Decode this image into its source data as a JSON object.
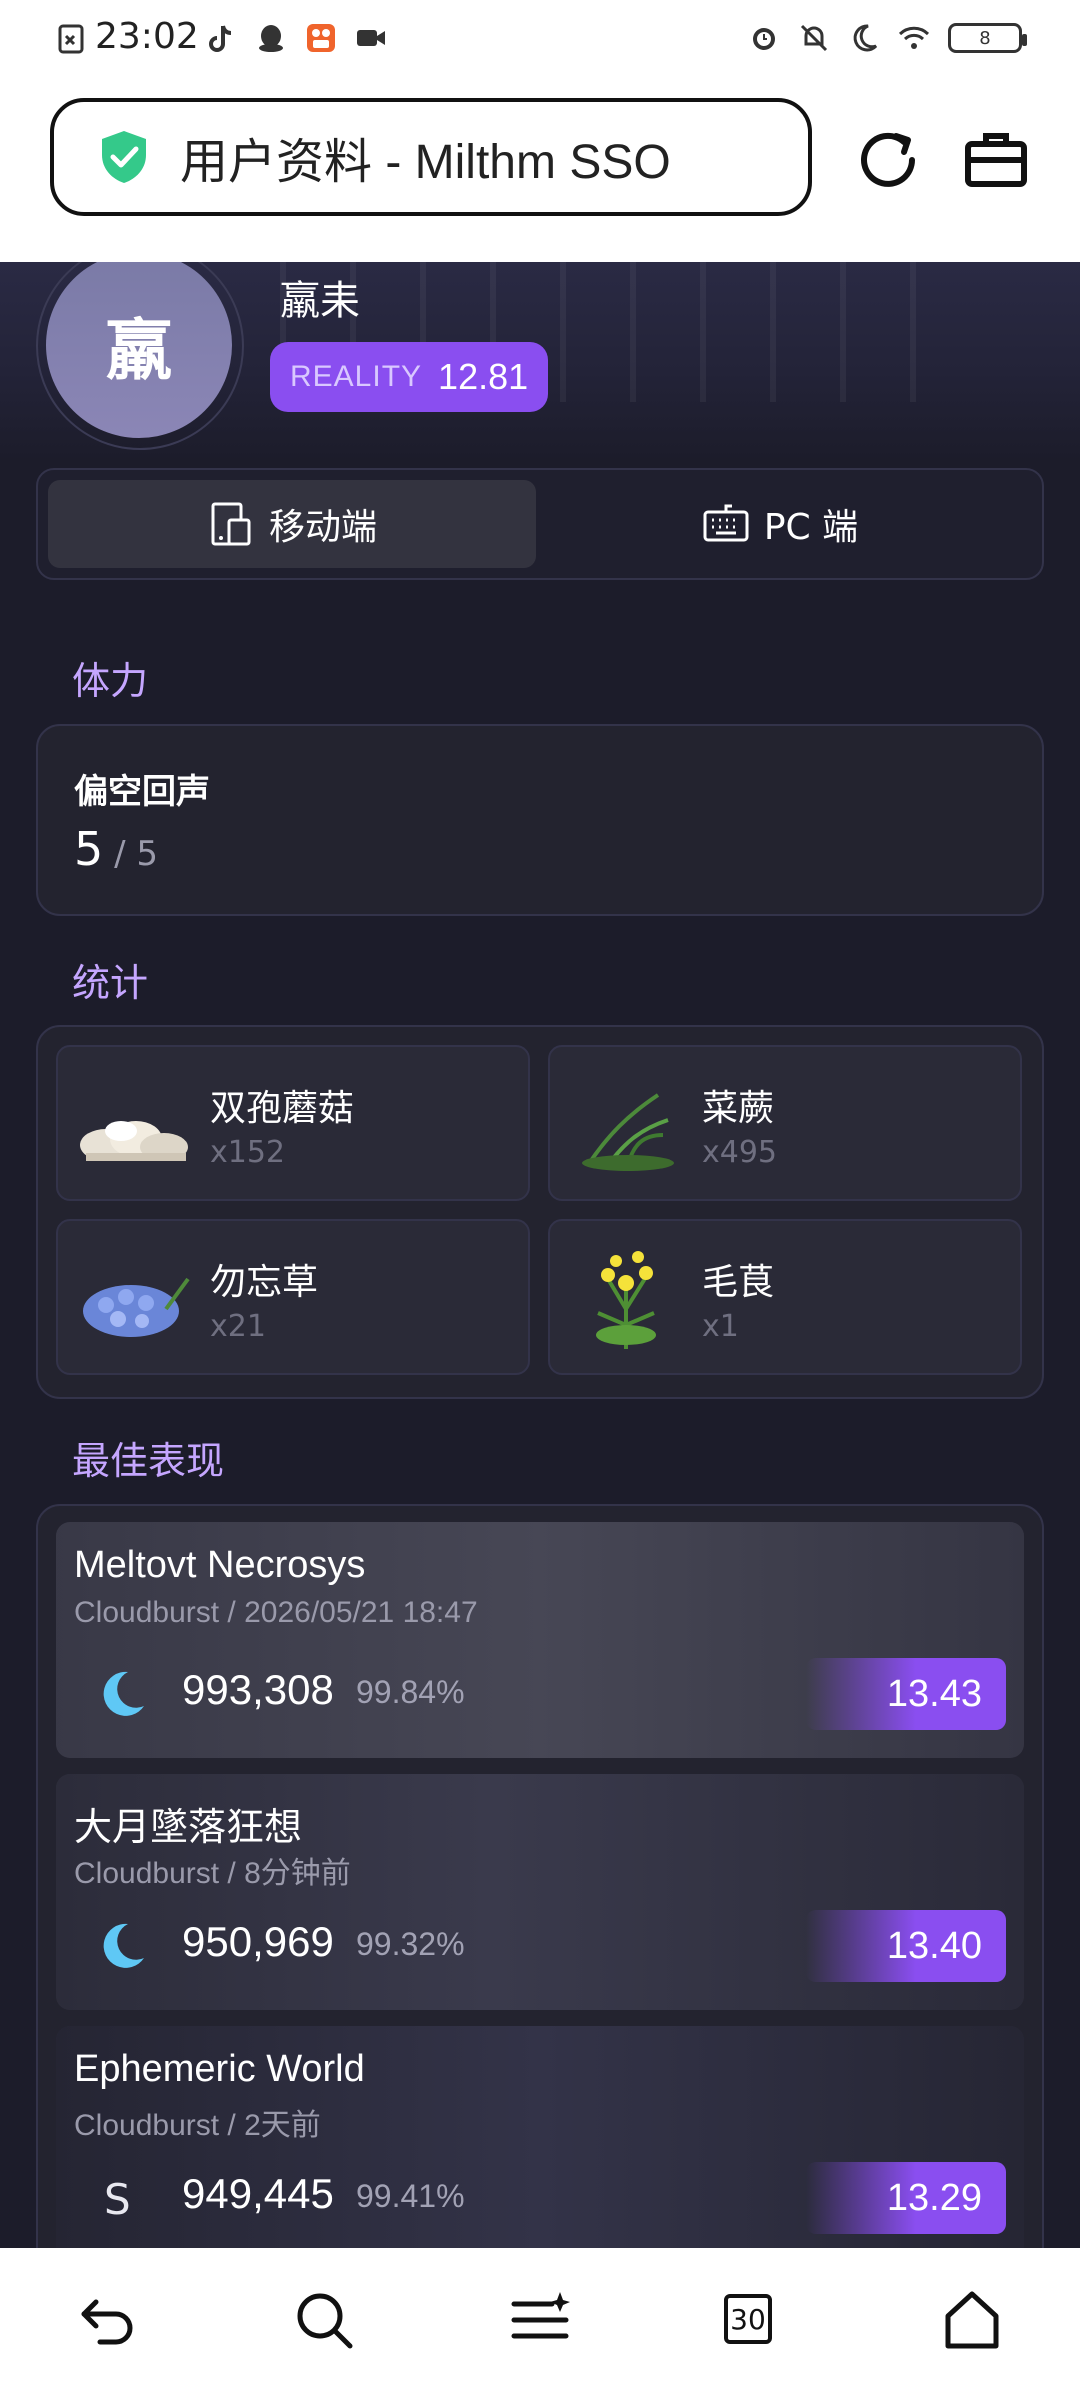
{
  "status_bar": {
    "time": "23:02",
    "battery": "8",
    "left_icons": [
      "image-error-icon",
      "tiktok-icon",
      "qq-icon",
      "app-icon",
      "video-icon"
    ],
    "right_icons": [
      "alarm-icon",
      "bell-off-icon",
      "moon-icon",
      "wifi-icon",
      "battery-icon"
    ]
  },
  "browser": {
    "url_title": "用户资料 - Milthm SSO",
    "icons": [
      "shield-check-icon",
      "refresh-icon",
      "toolbox-icon"
    ]
  },
  "profile": {
    "avatar_char": "羸",
    "name": "羸耒",
    "reality_label": "REALITY",
    "reality_value": "12.81"
  },
  "platform_tabs": [
    {
      "label": "移动端",
      "icon": "mobile-device-icon",
      "active": true
    },
    {
      "label": "PC 端",
      "icon": "keyboard-icon",
      "active": false
    }
  ],
  "stamina": {
    "section_title": "体力",
    "name": "偏空回声",
    "current": "5",
    "max": " / 5"
  },
  "stats": {
    "section_title": "统计",
    "items": [
      {
        "name": "双孢蘑菇",
        "count": "x152",
        "icon": "mushroom-icon"
      },
      {
        "name": "菜蕨",
        "count": "x495",
        "icon": "fern-icon"
      },
      {
        "name": "勿忘草",
        "count": "x21",
        "icon": "forget-me-not-icon"
      },
      {
        "name": "毛茛",
        "count": "x1",
        "icon": "buttercup-icon"
      }
    ]
  },
  "best": {
    "section_title": "最佳表现",
    "rows": [
      {
        "title": "Meltovt Necrosys",
        "sub": "Cloudburst / 2026/05/21 18:47",
        "grade": "moon",
        "score": "993,308",
        "accuracy": "99.84%",
        "rating": "13.43"
      },
      {
        "title": "大月墜落狂想",
        "sub": "Cloudburst / 8分钟前",
        "grade": "moon",
        "score": "950,969",
        "accuracy": "99.32%",
        "rating": "13.40"
      },
      {
        "title": "Ephemeric World",
        "sub": "Cloudburst / 2天前",
        "grade": "S",
        "score": "949,445",
        "accuracy": "99.41%",
        "rating": "13.29"
      }
    ]
  },
  "bottom_nav": [
    "back-icon",
    "search-icon",
    "menu-icon",
    "tabs-icon",
    "home-icon"
  ],
  "tabs_count": "30",
  "colors": {
    "accent": "#8a4ef0",
    "section_title": "#c5a6ff",
    "background": "#1c1c2a"
  }
}
